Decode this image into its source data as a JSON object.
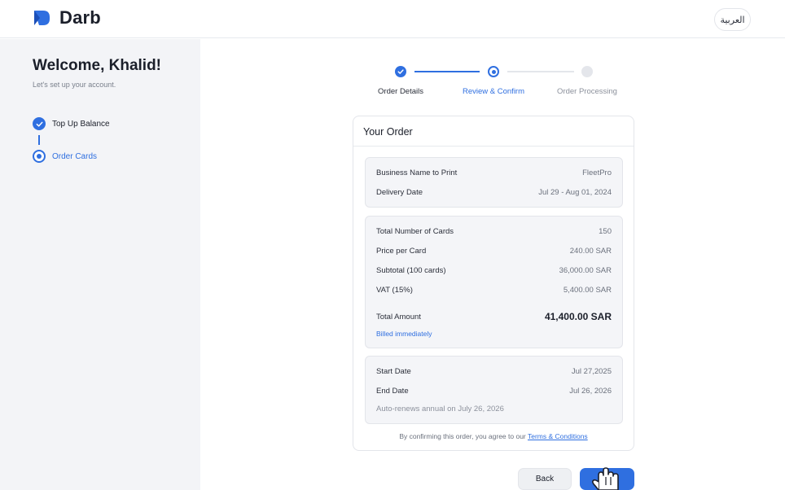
{
  "app": {
    "brand": "Darb",
    "language_toggle": "العربية",
    "colors": {
      "accent": "#2f6fe0",
      "sidebar_bg": "#f3f4f7",
      "text": "#1b1f2a"
    }
  },
  "sidebar": {
    "title": "Welcome, Khalid!",
    "subtitle": "Let's set up your account.",
    "steps": [
      {
        "label": "Top Up Balance",
        "state": "done"
      },
      {
        "label": "Order Cards",
        "state": "current"
      }
    ]
  },
  "stepper": {
    "steps": [
      {
        "label": "Order Details",
        "state": "done"
      },
      {
        "label": "Review & Confirm",
        "state": "current"
      },
      {
        "label": "Order Processing",
        "state": "todo"
      }
    ]
  },
  "order": {
    "title": "Your Order",
    "business_name_label": "Business Name to Print",
    "business_name_value": "FleetPro",
    "delivery_date_label": "Delivery Date",
    "delivery_date_value": "Jul 29 - Aug 01, 2024",
    "total_cards_label": "Total Number of Cards",
    "total_cards_value": "150",
    "price_per_card_label": "Price per Card",
    "price_per_card_value": "240.00 SAR",
    "subtotal_label": "Subtotal (100 cards)",
    "subtotal_value": "36,000.00 SAR",
    "vat_label": "VAT (15%)",
    "vat_value": "5,400.00 SAR",
    "total_amount_label": "Total Amount",
    "total_amount_value": "41,400.00 SAR",
    "billed_note": "Billed immediately",
    "start_date_label": "Start Date",
    "start_date_value": "Jul 27,2025",
    "end_date_label": "End Date",
    "end_date_value": "Jul 26, 2026",
    "auto_renew_note": "Auto-renews annual on July 26, 2026",
    "terms_prefix": "By confirming this order, you agree to our",
    "terms_link": "Terms & Conditions"
  },
  "actions": {
    "back_label": "Back",
    "confirm_label": ""
  }
}
